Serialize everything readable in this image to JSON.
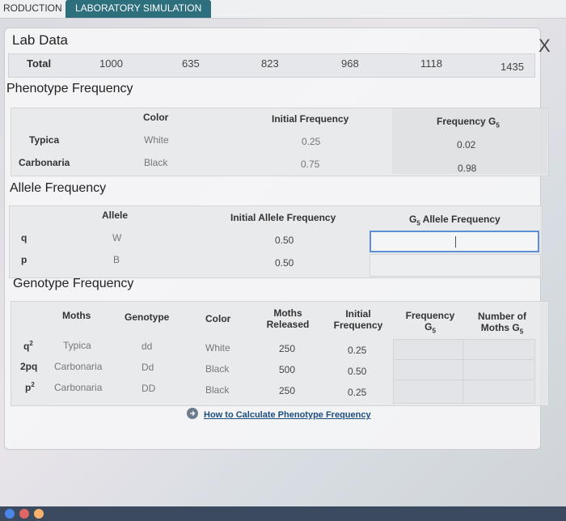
{
  "tabs": {
    "intro": "RODUCTION",
    "lab": "LABORATORY SIMULATION"
  },
  "lab": {
    "title": "Lab Data",
    "close": "X"
  },
  "generations": {
    "label": "Total",
    "values": [
      "1000",
      "635",
      "823",
      "968",
      "1118",
      "1435"
    ]
  },
  "phenotype": {
    "title": "Phenotype Frequency",
    "headers": {
      "color": "Color",
      "initial": "Initial Frequency",
      "g5": "Frequency G",
      "g5_sub": "5"
    },
    "rows": [
      {
        "name": "Typica",
        "color": "White",
        "initial": "0.25",
        "g5": "0.02"
      },
      {
        "name": "Carbonaria",
        "color": "Black",
        "initial": "0.75",
        "g5": "0.98"
      }
    ]
  },
  "allele": {
    "title": "Allele Frequency",
    "headers": {
      "allele": "Allele",
      "initial": "Initial Allele Frequency",
      "g5_prefix": "G",
      "g5_sub": "5",
      "g5_suffix": " Allele Frequency"
    },
    "rows": [
      {
        "sym": "q",
        "allele": "W",
        "initial": "0.50"
      },
      {
        "sym": "p",
        "allele": "B",
        "initial": "0.50"
      }
    ],
    "input_value": ""
  },
  "genotype": {
    "title": "Genotype Frequency",
    "headers": {
      "moths": "Moths",
      "genotype": "Genotype",
      "color": "Color",
      "released_1": "Moths",
      "released_2": "Released",
      "initial_1": "Initial",
      "initial_2": "Frequency",
      "freq_1": "Frequency",
      "freq_2": "G",
      "freq_sub": "5",
      "num_1": "Number of",
      "num_2": "Moths G",
      "num_sub": "5"
    },
    "rows": [
      {
        "sym": "q",
        "sup": "2",
        "moths": "Typica",
        "genotype": "dd",
        "color": "White",
        "released": "250",
        "initial": "0.25"
      },
      {
        "sym": "2pq",
        "sup": "",
        "moths": "Carbonaria",
        "genotype": "Dd",
        "color": "Black",
        "released": "500",
        "initial": "0.50"
      },
      {
        "sym": "p",
        "sup": "2",
        "moths": "Carbonaria",
        "genotype": "DD",
        "color": "Black",
        "released": "250",
        "initial": "0.25"
      }
    ]
  },
  "link": {
    "label": "How to Calculate Phenotype Frequency"
  },
  "colors": {
    "accent": "#2e6f7d",
    "input_border": "#5b8fd6",
    "link": "#1b4d7e"
  }
}
